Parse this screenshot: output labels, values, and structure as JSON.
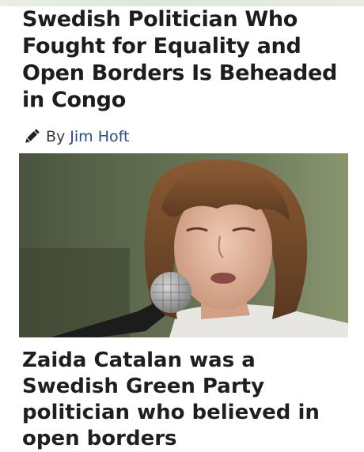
{
  "article": {
    "headline": "Swedish Politician Who Fought for Equality and Open Borders Is Beheaded in Congo",
    "byline": {
      "prefix": "By",
      "author": "Jim Hoft",
      "icon": "pencil-icon"
    },
    "photo": {
      "subject": "woman speaking into microphone"
    },
    "caption": "Zaida Catalan was a Swedish Green Party politician who believed in open borders"
  },
  "colors": {
    "headline": "#1d1d1f",
    "author_link": "#2b4a86",
    "byline_text": "#3a3a3a"
  }
}
